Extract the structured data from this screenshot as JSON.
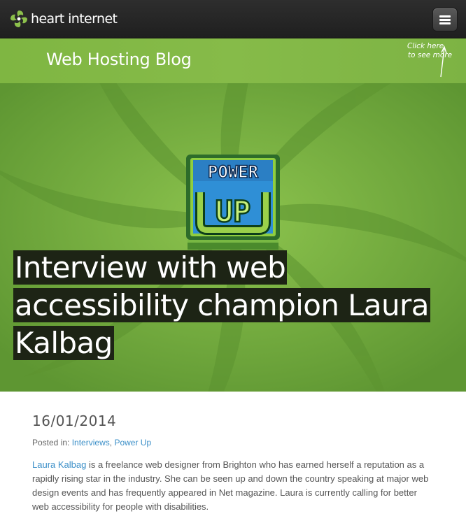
{
  "header": {
    "brand": "heart internet",
    "menu_icon": "hamburger-menu-icon"
  },
  "blog_bar": {
    "title": "Web Hosting Blog",
    "note_line1": "Click here",
    "note_line2": "to see more"
  },
  "hero": {
    "badge_line1": "POWER",
    "badge_line2": "UP",
    "title_line1": "Interview with web",
    "title_line2": "accessibility champion Laura",
    "title_line3": "Kalbag"
  },
  "article": {
    "date": "16/01/2014",
    "posted_prefix": "Posted in:",
    "categories": [
      "Interviews",
      "Power Up"
    ],
    "category_separator": ",",
    "author_link": "Laura Kalbag",
    "intro": "is a freelance web designer from Brighton who has earned herself a reputation as a rapidly rising star in the industry. She can be seen up and down the country speaking at major web design events and has frequently appeared in Net magazine. Laura is currently calling for better web accessibility for people with disabilities."
  },
  "colors": {
    "topbar": "#262626",
    "green": "#82b846",
    "link": "#3b8fc8",
    "title_highlight": "#1d2415"
  }
}
